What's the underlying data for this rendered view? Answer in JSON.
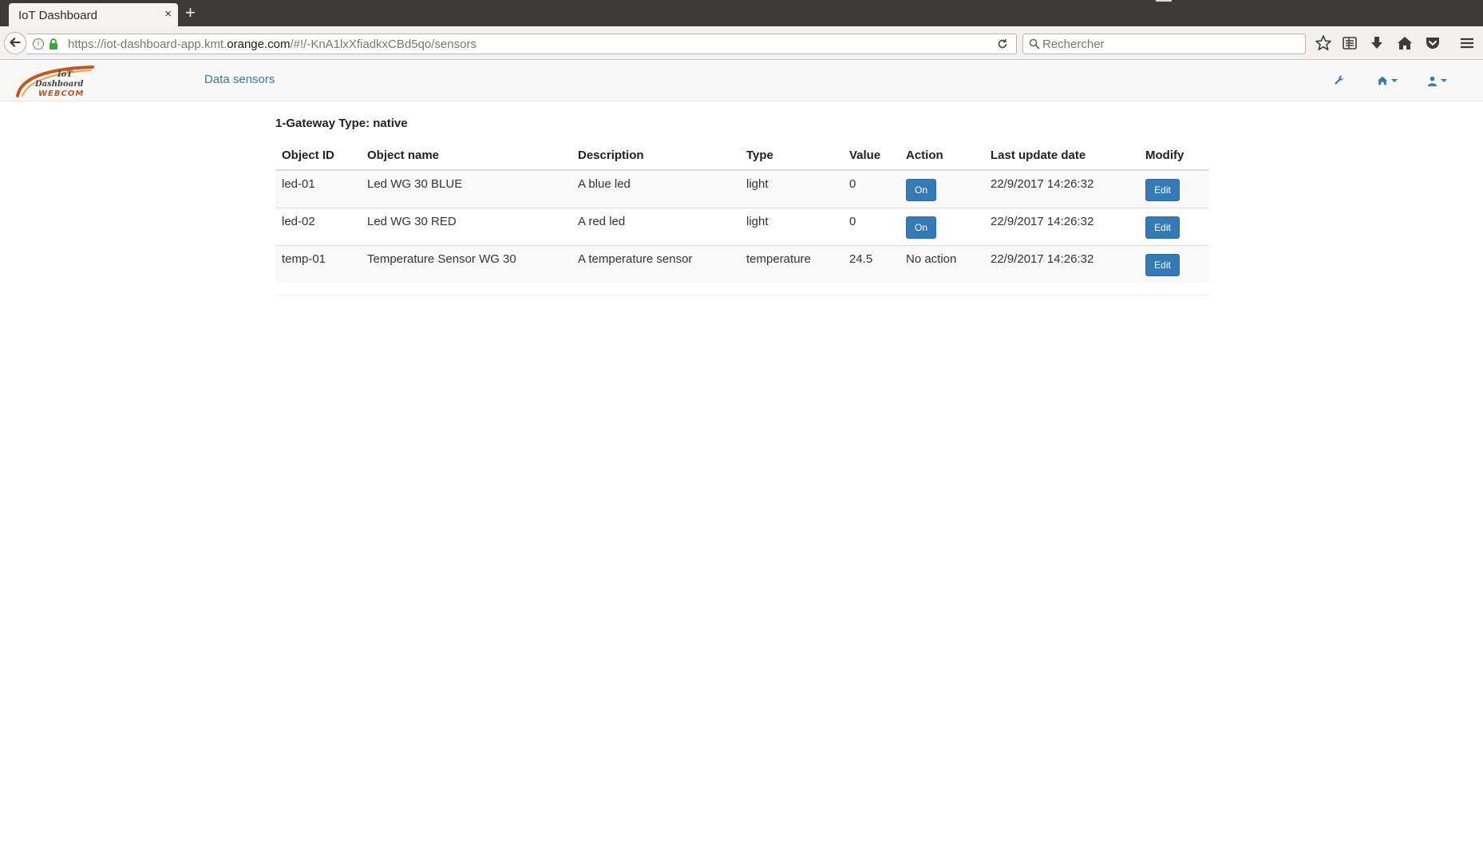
{
  "browser": {
    "tab_title": "IoT Dashboard",
    "tab_close": "×",
    "new_tab": "+",
    "url_prefix": "https://iot-dashboard-app.kmt.",
    "url_domain": "orange.com",
    "url_suffix": "/#!/-KnA1lxXfiadkxCBd5qo/sensors",
    "search_placeholder": "Rechercher"
  },
  "appbar": {
    "logo_text_1": "IoT",
    "logo_text_2": "Dashboard",
    "logo_text_3": "WEBCOM",
    "nav_link": "Data sensors",
    "accent": "#337ab7"
  },
  "gateway": {
    "title": "1-Gateway Type: native"
  },
  "table": {
    "headers": [
      "Object ID",
      "Object name",
      "Description",
      "Type",
      "Value",
      "Action",
      "Last update date",
      "Modify"
    ],
    "rows": [
      {
        "id": "led-01",
        "name": "Led WG 30 BLUE",
        "description": "A blue led",
        "type": "light",
        "value": "0",
        "action": "On",
        "date": "22/9/2017 14:26:32",
        "modify": "Edit"
      },
      {
        "id": "led-02",
        "name": "Led WG 30 RED",
        "description": "A red led",
        "type": "light",
        "value": "0",
        "action": "On",
        "date": "22/9/2017 14:26:32",
        "modify": "Edit"
      },
      {
        "id": "temp-01",
        "name": "Temperature Sensor WG 30",
        "description": "A temperature sensor",
        "type": "temperature",
        "value": "24.5",
        "action": "No action",
        "date": "22/9/2017 14:26:32",
        "modify": "Edit"
      }
    ]
  }
}
